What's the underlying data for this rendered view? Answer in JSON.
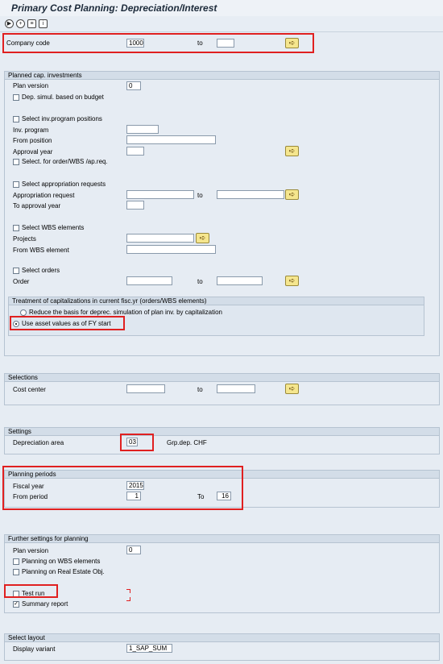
{
  "title": "Primary Cost Planning: Depreciation/Interest",
  "toolbar": {
    "icons": [
      "execute-icon",
      "save-variant-icon",
      "list-icon",
      "information-icon"
    ]
  },
  "company": {
    "label": "Company code",
    "value": "1000",
    "to_label": "to",
    "to_value": ""
  },
  "planned": {
    "header": "Planned cap. investments",
    "plan_version_label": "Plan version",
    "plan_version_value": "0",
    "dep_simul_label": "Dep. simul. based on budget",
    "select_inv_label": "Select inv.program positions",
    "inv_program_label": "Inv. program",
    "from_position_label": "From position",
    "approval_year_label": "Approval year",
    "select_for_order_label": "Select. for order/WBS /ap.req.",
    "select_approp_label": "Select appropriation requests",
    "approp_request_label": "Appropriation request",
    "approp_to_label": "to",
    "to_approval_year_label": "To approval year",
    "select_wbs_label": "Select WBS elements",
    "projects_label": "Projects",
    "from_wbs_label": "From WBS element",
    "select_orders_label": "Select orders",
    "order_label": "Order",
    "order_to_label": "to",
    "treatment_header": "Treatment of capitalizations in current fisc.yr (orders/WBS elements)",
    "reduce_label": "Reduce the basis for deprec. simulation of plan inv. by capitalization",
    "use_asset_label": "Use asset values as of FY start"
  },
  "selections": {
    "header": "Selections",
    "cost_center_label": "Cost center",
    "to_label": "to"
  },
  "settings": {
    "header": "Settings",
    "dep_area_label": "Depreciation area",
    "dep_area_value": "03",
    "dep_area_desc": "Grp.dep. CHF"
  },
  "periods": {
    "header": "Planning periods",
    "fiscal_year_label": "Fiscal year",
    "fiscal_year_value": "2015",
    "from_period_label": "From period",
    "from_period_value": "1",
    "to_label": "To",
    "to_value": "16"
  },
  "further": {
    "header": "Further settings for planning",
    "plan_version_label": "Plan version",
    "plan_version_value": "0",
    "planning_wbs_label": "Planning on WBS elements",
    "planning_re_label": "Planning on Real Estate Obj.",
    "test_run_label": "Test run",
    "summary_report_label": "Summary report"
  },
  "layout": {
    "header": "Select layout",
    "display_variant_label": "Display variant",
    "display_variant_value": "1_SAP_SUM"
  },
  "colors": {
    "background": "#e6ecf3",
    "header_bg": "#d3dde8",
    "highlight": "#e02020",
    "button": "#f5e68e"
  }
}
